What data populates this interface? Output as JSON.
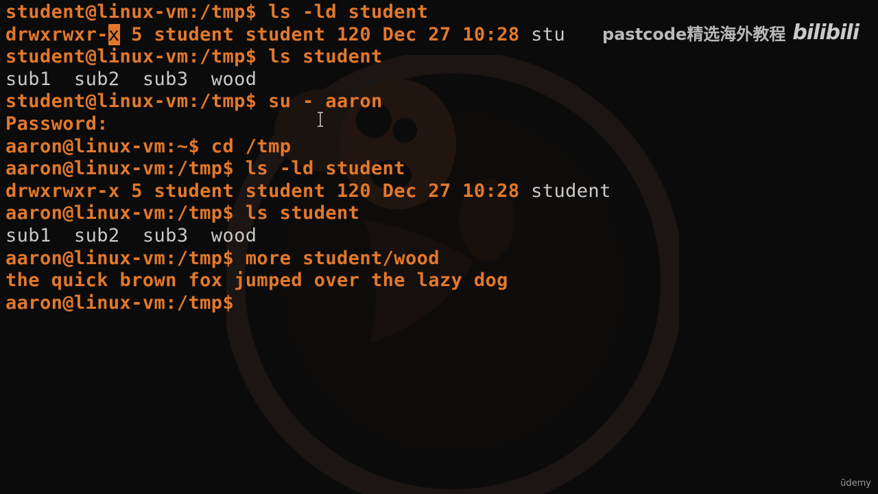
{
  "terminal": {
    "lines": [
      {
        "prompt": "student@linux-vm:/tmp$",
        "cmd": " ls -ld student"
      },
      {
        "pre": "drwxrwxr-",
        "highlight": "x",
        "rest": " 5 student student 120 Dec 27 10:28 ",
        "tail": "stu"
      },
      {
        "prompt": "student@linux-vm:/tmp$",
        "cmd": " ls student"
      },
      {
        "out": "sub1  sub2  sub3  wood"
      },
      {
        "prompt": "student@linux-vm:/tmp$",
        "cmd": " su - aaron"
      },
      {
        "prompt": "Password:",
        "cmd": ""
      },
      {
        "prompt": "aaron@linux-vm:~$",
        "cmd": " cd /tmp"
      },
      {
        "prompt": "aaron@linux-vm:/tmp$",
        "cmd": " ls -ld student"
      },
      {
        "pre": "drwxrwxr-x 5 student student 120 Dec 27 10:28 ",
        "tail": "student"
      },
      {
        "prompt": "aaron@linux-vm:/tmp$",
        "cmd": " ls student"
      },
      {
        "out": "sub1  sub2  sub3  wood"
      },
      {
        "prompt": "aaron@linux-vm:/tmp$",
        "cmd": " more student/wood"
      },
      {
        "orange_out": "the quick brown fox jumped over the lazy dog"
      },
      {
        "prompt": "aaron@linux-vm:/tmp$",
        "cmd": ""
      }
    ]
  },
  "watermark": {
    "text": "pastcode精选海外教程",
    "logo": "bilibili"
  },
  "footer": {
    "brand": "ūdemy"
  },
  "colors": {
    "accent_orange": "#e2782c",
    "output_gray": "#c9c9c9",
    "background": "#0b0b0b"
  }
}
